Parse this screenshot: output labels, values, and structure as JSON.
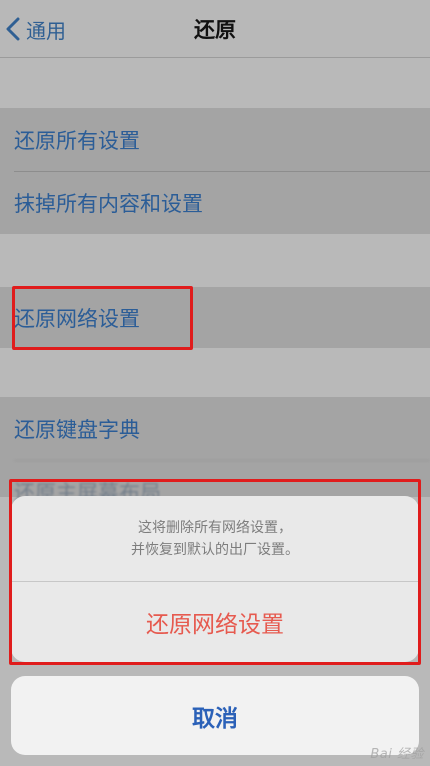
{
  "nav": {
    "back_label": "通用",
    "title": "还原"
  },
  "group1": {
    "items": [
      {
        "label": "还原所有设置"
      },
      {
        "label": "抹掉所有内容和设置"
      }
    ]
  },
  "group2": {
    "items": [
      {
        "label": "还原网络设置"
      }
    ]
  },
  "group3": {
    "items": [
      {
        "label": "还原键盘字典"
      },
      {
        "label": "还原主屏幕布局"
      }
    ]
  },
  "sheet": {
    "message_line1": "这将删除所有网络设置，",
    "message_line2": "并恢复到默认的出厂设置。",
    "action_label": "还原网络设置",
    "cancel_label": "取消"
  },
  "watermark": "Bai 经验",
  "colors": {
    "link_blue": "#2b5d97",
    "destructive_red": "#e65a4f",
    "highlight_red": "#e01c1c"
  }
}
